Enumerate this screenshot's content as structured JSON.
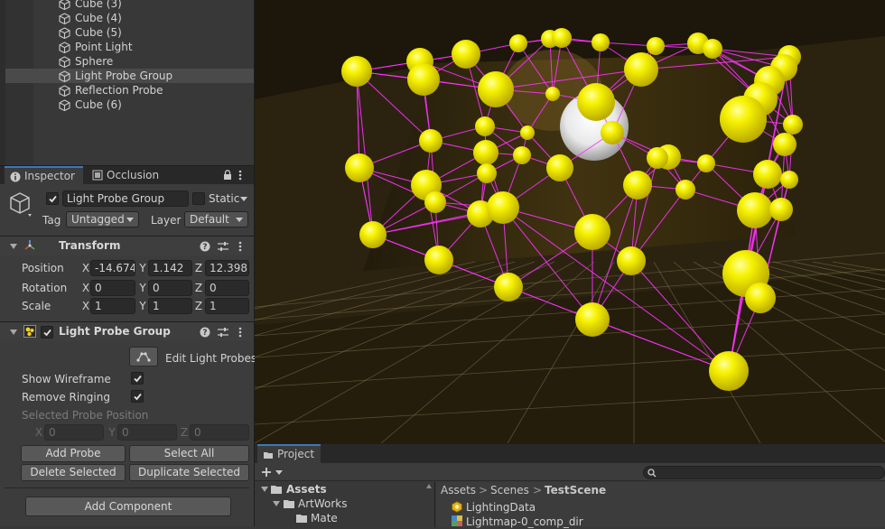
{
  "hierarchy": {
    "items": [
      {
        "label": "Cube (3)",
        "selected": false
      },
      {
        "label": "Cube (4)",
        "selected": false
      },
      {
        "label": "Cube (5)",
        "selected": false
      },
      {
        "label": "Point Light",
        "selected": false
      },
      {
        "label": "Sphere",
        "selected": false
      },
      {
        "label": "Light Probe Group",
        "selected": true
      },
      {
        "label": "Reflection Probe",
        "selected": false
      },
      {
        "label": "Cube (6)",
        "selected": false
      }
    ]
  },
  "tabs": {
    "inspector": "Inspector",
    "occlusion": "Occlusion"
  },
  "object": {
    "name": "Light Probe Group",
    "static_label": "Static",
    "tag_label": "Tag",
    "tag_value": "Untagged",
    "layer_label": "Layer",
    "layer_value": "Default"
  },
  "transform": {
    "title": "Transform",
    "position_label": "Position",
    "rotation_label": "Rotation",
    "scale_label": "Scale",
    "axes": [
      "X",
      "Y",
      "Z"
    ],
    "position": [
      "-14.674",
      "1.142",
      "12.398"
    ],
    "rotation": [
      "0",
      "0",
      "0"
    ],
    "scale": [
      "1",
      "1",
      "1"
    ]
  },
  "light_probe_group": {
    "title": "Light Probe Group",
    "edit_label": "Edit Light Probes",
    "show_wireframe_label": "Show Wireframe",
    "remove_ringing_label": "Remove Ringing",
    "selected_probe_label": "Selected Probe Position",
    "selected_probe": [
      "0",
      "0",
      "0"
    ],
    "add_probe": "Add Probe",
    "select_all": "Select All",
    "delete_selected": "Delete Selected",
    "duplicate_selected": "Duplicate Selected"
  },
  "add_component": "Add Component",
  "project": {
    "tab": "Project",
    "tree": [
      {
        "label": "Assets"
      },
      {
        "label": "ArtWorks"
      },
      {
        "label": "Mate"
      }
    ],
    "breadcrumb": [
      "Assets",
      "Scenes",
      "TestScene"
    ],
    "files": [
      "LightingData",
      "Lightmap-0_comp_dir"
    ]
  },
  "colors": {
    "probe": "#f4f000",
    "wire": "#ff33ff",
    "accent": "#3a79bb"
  }
}
